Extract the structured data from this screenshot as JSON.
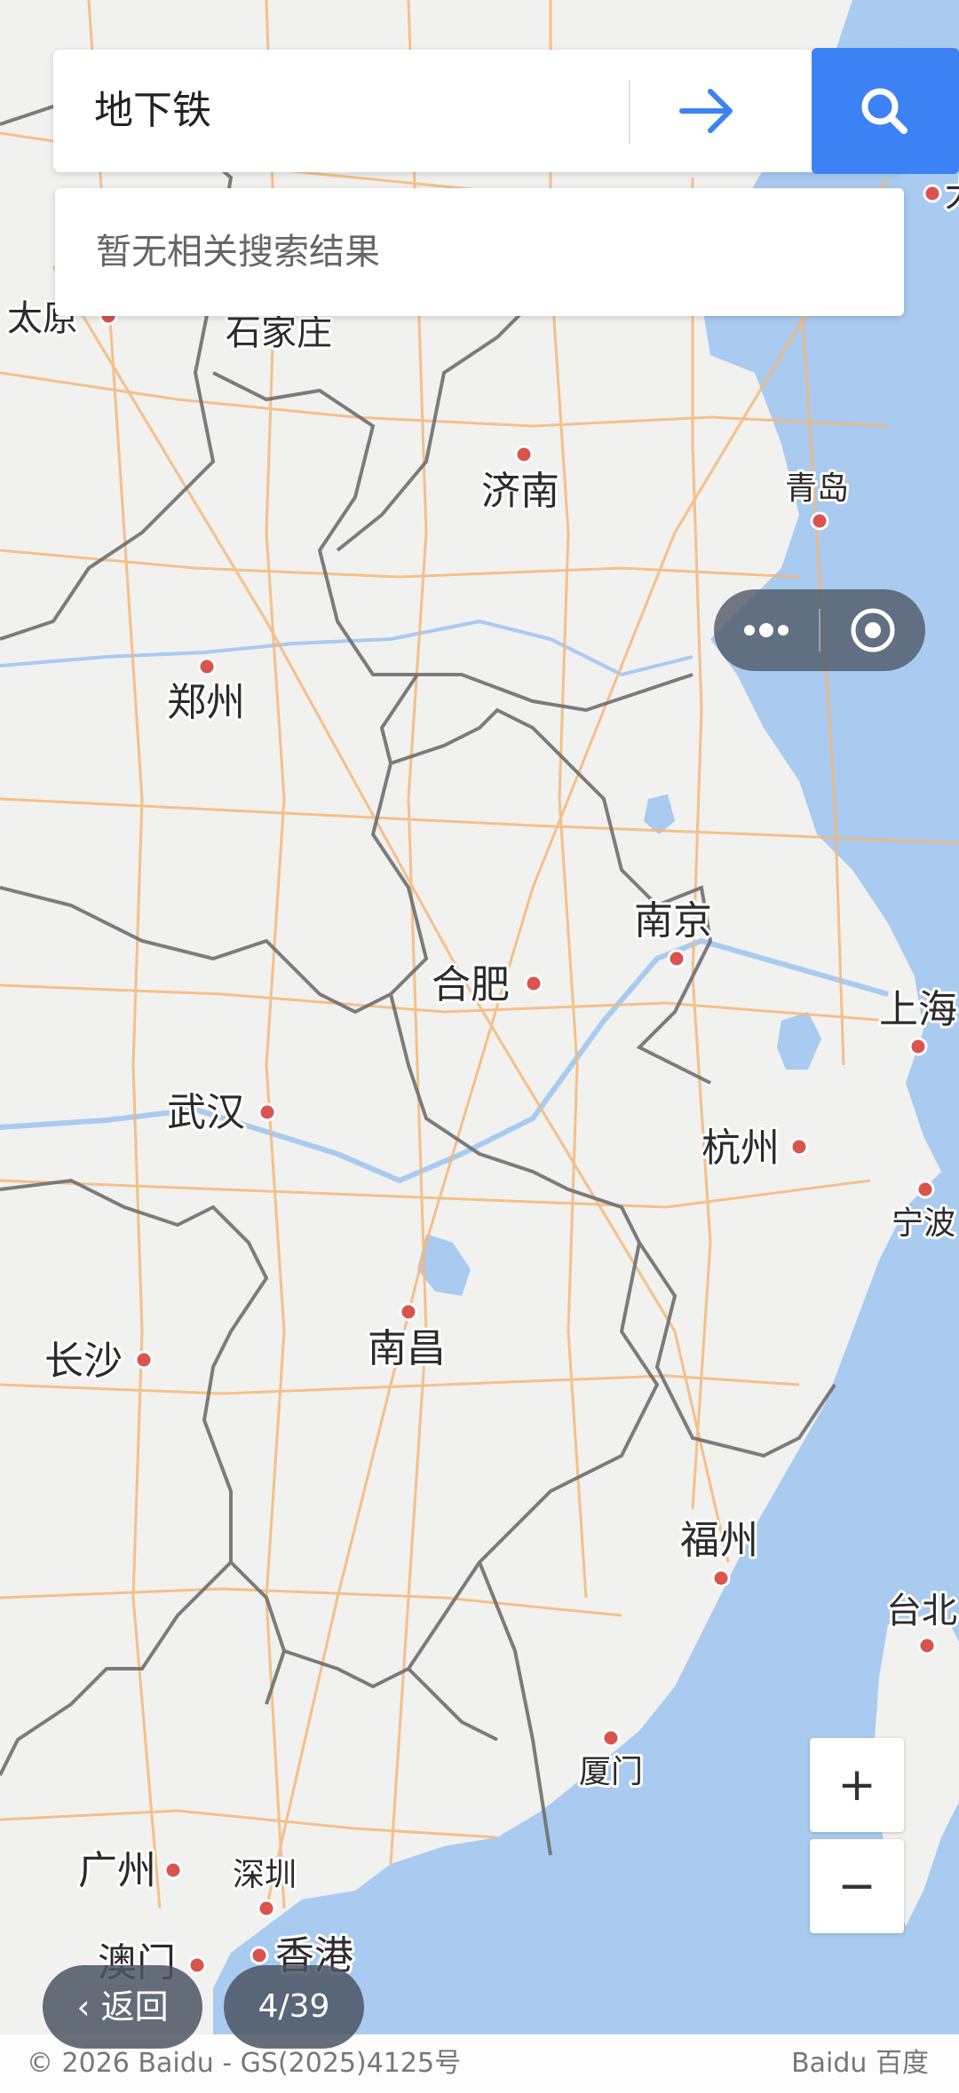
{
  "search": {
    "query": "地下铁",
    "no_results": "暂无相关搜索结果"
  },
  "icons": {
    "go": "arrow-right-icon",
    "search": "search-icon",
    "more": "more-dots-icon",
    "close": "target-close-icon"
  },
  "map": {
    "cities": [
      {
        "name": "太原"
      },
      {
        "name": "石家庄"
      },
      {
        "name": "济南"
      },
      {
        "name": "青岛"
      },
      {
        "name": "郑州"
      },
      {
        "name": "南京"
      },
      {
        "name": "合肥"
      },
      {
        "name": "上海"
      },
      {
        "name": "武汉"
      },
      {
        "name": "杭州"
      },
      {
        "name": "宁波"
      },
      {
        "name": "南昌"
      },
      {
        "name": "长沙"
      },
      {
        "name": "福州"
      },
      {
        "name": "台北"
      },
      {
        "name": "厦门"
      },
      {
        "name": "广州"
      },
      {
        "name": "深圳"
      },
      {
        "name": "香港"
      },
      {
        "name": "澳门"
      }
    ],
    "partial_label": "大"
  },
  "zoom": {
    "in": "+",
    "out": "−"
  },
  "nav": {
    "back": "‹ 返回",
    "page": "4/39"
  },
  "footer": {
    "copyright": "© 2026 Baidu - GS(2025)4125号",
    "brand": "Baidu 百度"
  },
  "colors": {
    "land": "#f1f1ef",
    "sea": "#a9cbf0",
    "road": "#f5b87a",
    "border": "#6f6f6f",
    "accent": "#3d82f5"
  }
}
